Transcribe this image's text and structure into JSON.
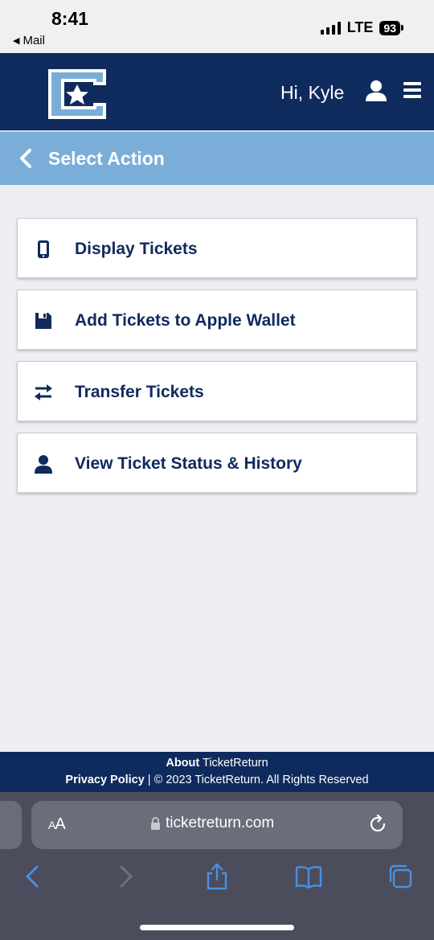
{
  "status_bar": {
    "time": "8:41",
    "back_app": "Mail",
    "network": "LTE",
    "battery": "93"
  },
  "header": {
    "greeting": "Hi, Kyle",
    "logo_icon": "college-c-star-logo",
    "user_icon": "user-icon",
    "menu_icon": "hamburger-menu-icon"
  },
  "section": {
    "title": "Select Action"
  },
  "actions": [
    {
      "label": "Display Tickets",
      "icon": "phone-icon"
    },
    {
      "label": "Add Tickets to Apple Wallet",
      "icon": "save-icon"
    },
    {
      "label": "Transfer Tickets",
      "icon": "transfer-icon"
    },
    {
      "label": "View Ticket Status & History",
      "icon": "user-icon"
    }
  ],
  "footer": {
    "about_label": "About",
    "about_brand": "TicketReturn",
    "privacy_label": "Privacy Policy",
    "copyright": "2023 TicketReturn. All Rights Reserved"
  },
  "safari": {
    "text_size_label": "AA",
    "url": "ticketreturn.com"
  },
  "colors": {
    "navy": "#0f2a5c",
    "light_blue": "#7aaed8",
    "page_bg": "#efeef3",
    "safari_bg": "#4b4d5c",
    "safari_accent": "#4a90e2"
  }
}
